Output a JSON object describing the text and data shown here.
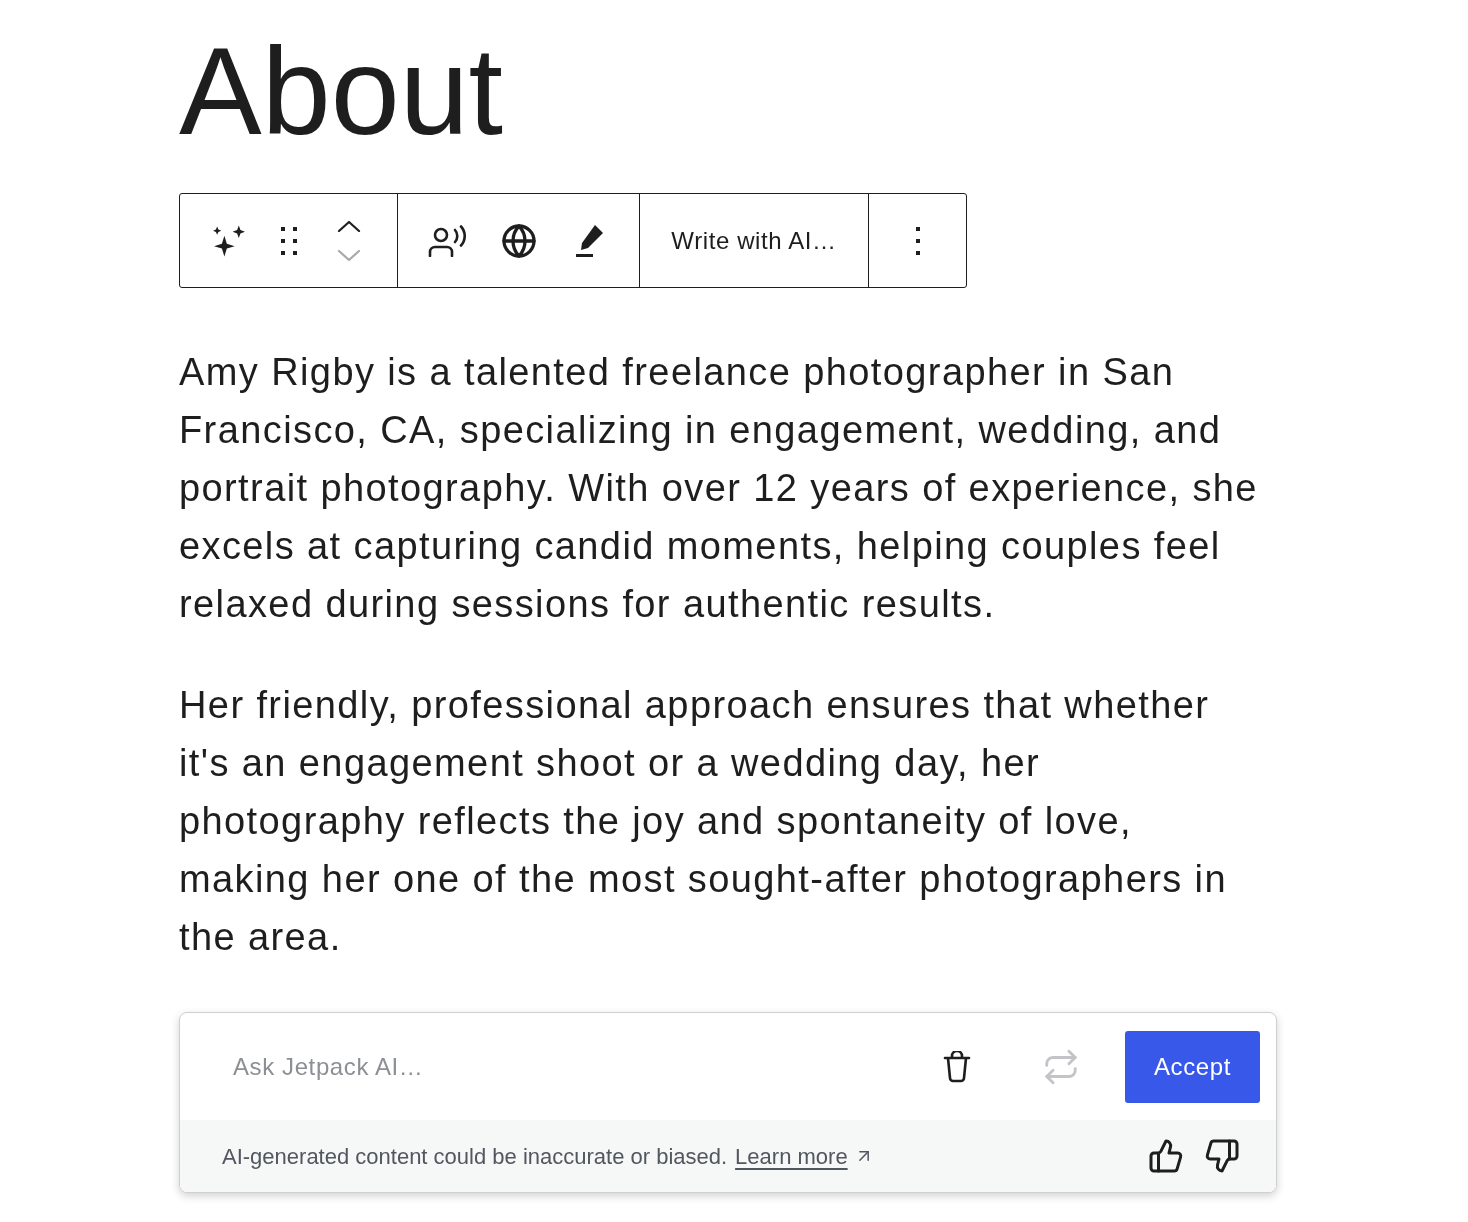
{
  "heading": {
    "text": "About"
  },
  "toolbar": {
    "move_up": {
      "disabled": false
    },
    "move_down": {
      "disabled": true
    },
    "write_button": {
      "label": "Write with AI…"
    }
  },
  "paragraphs": [
    "Amy Rigby is a talented freelance photographer in San Francisco, CA, specializing in engagement, wedding, and portrait photography. With over 12 years of experience, she excels at capturing candid moments, helping couples feel relaxed during sessions for authentic results.",
    "Her friendly, professional approach ensures that whether it's an engagement shoot or a wedding day, her photography reflects the joy and spontaneity of love, making her one of the most sought-after photographers in the area."
  ],
  "ai_panel": {
    "prompt": {
      "placeholder": "Ask Jetpack AI…"
    },
    "regenerate": {
      "disabled": true
    },
    "accept_button": {
      "label": "Accept"
    },
    "disclaimer": "AI-generated content could be inaccurate or biased.",
    "learn_more": {
      "label": "Learn more"
    }
  }
}
